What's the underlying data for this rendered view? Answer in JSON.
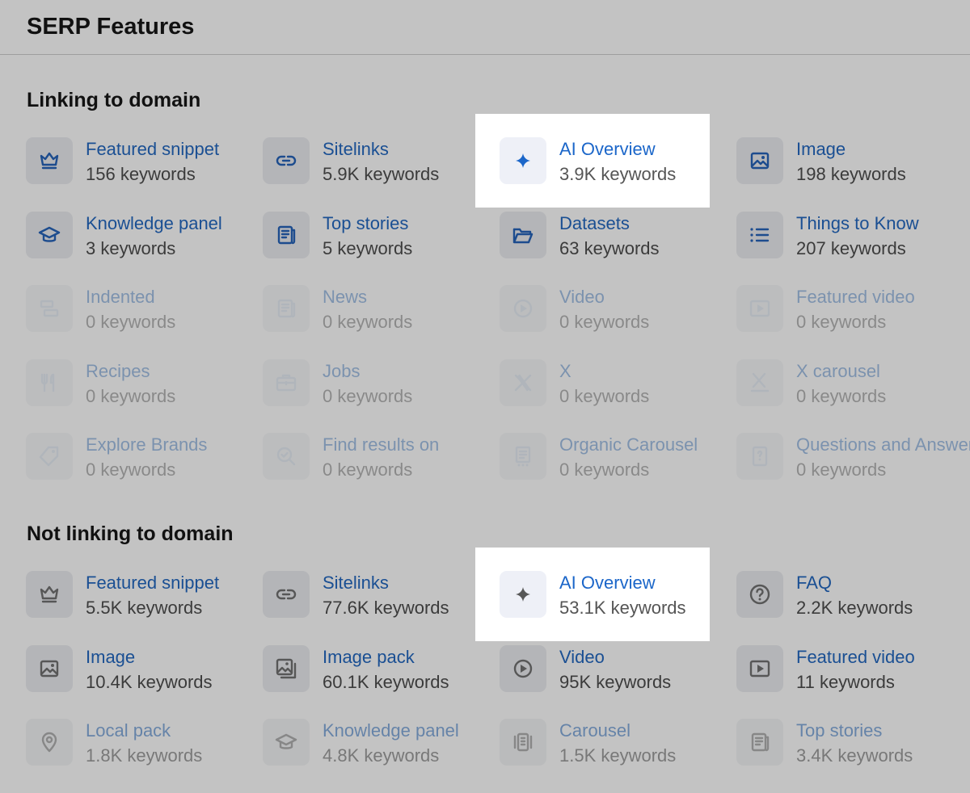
{
  "page": {
    "title": "SERP Features"
  },
  "colors": {
    "background": "#c3c3c3",
    "link": "#1a4f93",
    "count": "#3b3b3b",
    "icon_normal": "#1d4c8e",
    "icon_disabled": "#97a3b2",
    "icon_grey": "#575757",
    "highlight_link": "#1b66c9",
    "highlight_icon_blue": "#1b66c9"
  },
  "sections": [
    {
      "title": "Linking to domain",
      "items": [
        {
          "label": "Featured snippet",
          "count": "156 keywords",
          "icon": "crown-icon"
        },
        {
          "label": "Sitelinks",
          "count": "5.9K keywords",
          "icon": "link-icon"
        },
        {
          "label": "AI Overview",
          "count": "3.9K keywords",
          "icon": "ai-sparkle-icon"
        },
        {
          "label": "Image",
          "count": "198 keywords",
          "icon": "image-icon"
        },
        {
          "label": "Knowledge panel",
          "count": "3 keywords",
          "icon": "graduation-cap-icon"
        },
        {
          "label": "Top stories",
          "count": "5 keywords",
          "icon": "news-article-icon"
        },
        {
          "label": "Datasets",
          "count": "63 keywords",
          "icon": "folder-open-icon"
        },
        {
          "label": "Things to Know",
          "count": "207 keywords",
          "icon": "list-icon"
        },
        {
          "label": "Indented",
          "count": "0 keywords",
          "icon": "indent-icon"
        },
        {
          "label": "News",
          "count": "0 keywords",
          "icon": "news-article-icon"
        },
        {
          "label": "Video",
          "count": "0 keywords",
          "icon": "play-circle-icon"
        },
        {
          "label": "Featured video",
          "count": "0 keywords",
          "icon": "video-square-icon"
        },
        {
          "label": "Recipes",
          "count": "0 keywords",
          "icon": "cutlery-icon"
        },
        {
          "label": "Jobs",
          "count": "0 keywords",
          "icon": "briefcase-icon"
        },
        {
          "label": "X",
          "count": "0 keywords",
          "icon": "x-logo-icon"
        },
        {
          "label": "X carousel",
          "count": "0 keywords",
          "icon": "x-carousel-icon"
        },
        {
          "label": "Explore Brands",
          "count": "0 keywords",
          "icon": "tag-icon"
        },
        {
          "label": "Find results on",
          "count": "0 keywords",
          "icon": "search-check-icon"
        },
        {
          "label": "Organic Carousel",
          "count": "0 keywords",
          "icon": "carousel-doc-icon"
        },
        {
          "label": "Questions and Answers",
          "count": "0 keywords",
          "icon": "qa-book-icon"
        }
      ]
    },
    {
      "title": "Not linking to domain",
      "items": [
        {
          "label": "Featured snippet",
          "count": "5.5K keywords",
          "icon": "crown-icon"
        },
        {
          "label": "Sitelinks",
          "count": "77.6K keywords",
          "icon": "link-icon"
        },
        {
          "label": "AI Overview",
          "count": "53.1K keywords",
          "icon": "ai-sparkle-icon"
        },
        {
          "label": "FAQ",
          "count": "2.2K keywords",
          "icon": "question-circle-icon"
        },
        {
          "label": "Image",
          "count": "10.4K keywords",
          "icon": "image-icon"
        },
        {
          "label": "Image pack",
          "count": "60.1K keywords",
          "icon": "image-pack-icon"
        },
        {
          "label": "Video",
          "count": "95K keywords",
          "icon": "play-circle-icon"
        },
        {
          "label": "Featured video",
          "count": "11 keywords",
          "icon": "video-square-icon"
        },
        {
          "label": "Local pack",
          "count": "1.8K keywords",
          "icon": "map-pin-icon"
        },
        {
          "label": "Knowledge panel",
          "count": "4.8K keywords",
          "icon": "graduation-cap-icon"
        },
        {
          "label": "Carousel",
          "count": "1.5K keywords",
          "icon": "carousel-icon"
        },
        {
          "label": "Top stories",
          "count": "3.4K keywords",
          "icon": "news-article-icon"
        }
      ]
    }
  ]
}
